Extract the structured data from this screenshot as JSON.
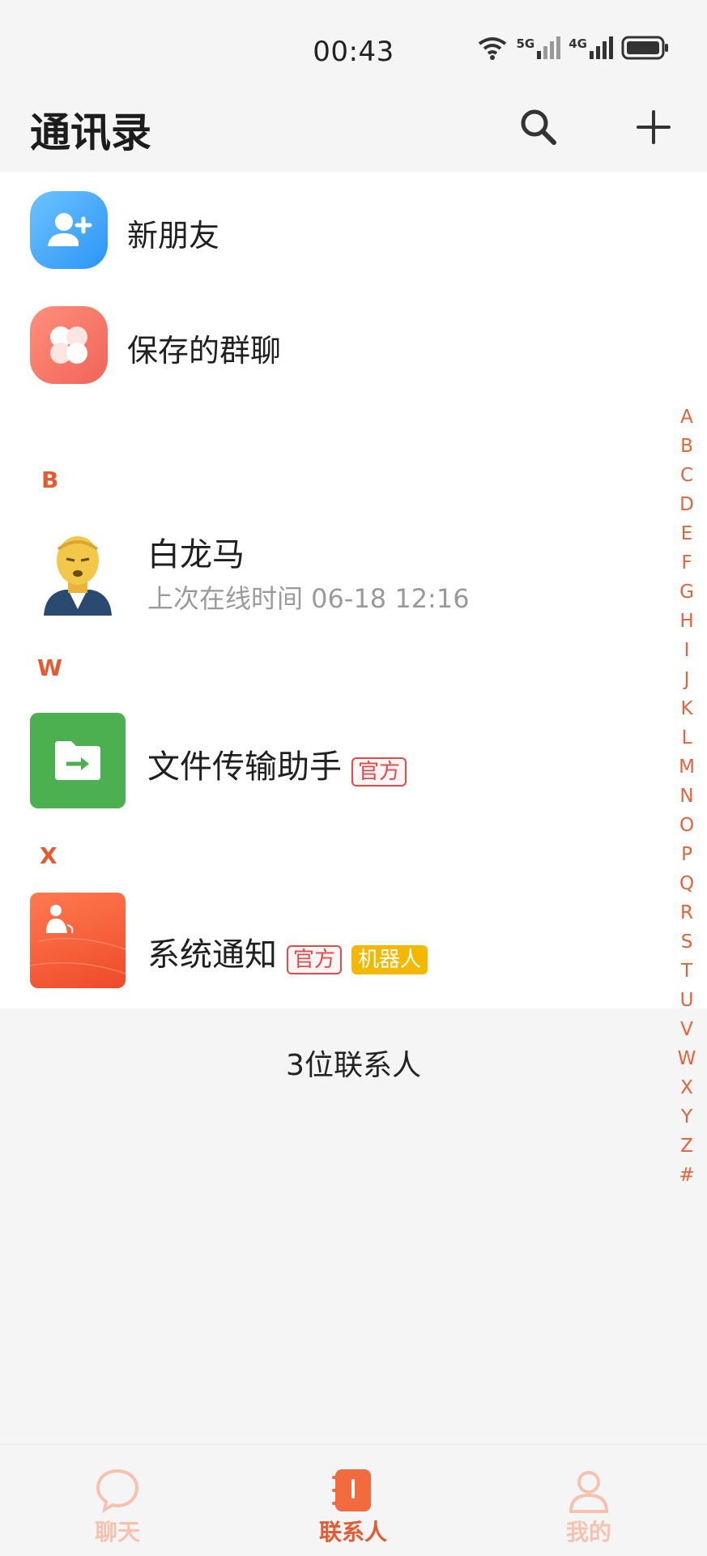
{
  "status": {
    "time": "00:43",
    "net1": "5G",
    "net2": "4G"
  },
  "header": {
    "title": "通讯录"
  },
  "shortcuts": [
    {
      "label": "新朋友"
    },
    {
      "label": "保存的群聊"
    }
  ],
  "sections": [
    {
      "letter": "B",
      "contacts": [
        {
          "name": "白龙马",
          "subtitle": "上次在线时间 06-18 12:16"
        }
      ]
    },
    {
      "letter": "W",
      "contacts": [
        {
          "name": "文件传输助手",
          "tags": [
            "官方"
          ]
        }
      ]
    },
    {
      "letter": "X",
      "contacts": [
        {
          "name": "系统通知",
          "tags": [
            "官方",
            "机器人"
          ]
        }
      ]
    }
  ],
  "index_letters": [
    "A",
    "B",
    "C",
    "D",
    "E",
    "F",
    "G",
    "H",
    "I",
    "J",
    "K",
    "L",
    "M",
    "N",
    "O",
    "P",
    "Q",
    "R",
    "S",
    "T",
    "U",
    "V",
    "W",
    "X",
    "Y",
    "Z",
    "#"
  ],
  "contact_count": "3位联系人",
  "tabs": [
    {
      "label": "聊天",
      "icon": "chat-bubble-icon",
      "active": false
    },
    {
      "label": "联系人",
      "icon": "contacts-book-icon",
      "active": true
    },
    {
      "label": "我的",
      "icon": "person-icon",
      "active": false
    }
  ],
  "colors": {
    "accent": "#e65a32",
    "tab_inactive": "#f5c2b0",
    "official_tag": "#e04b4b",
    "robot_tag": "#f5b800"
  }
}
